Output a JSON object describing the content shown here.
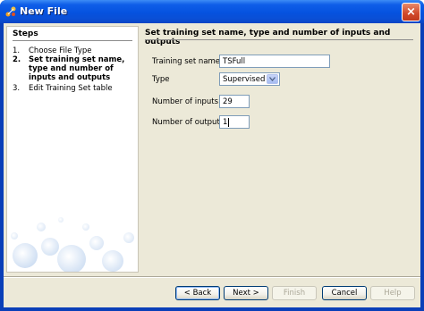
{
  "window": {
    "title": "New File",
    "app_icon": "app-icon",
    "close_icon": "close-icon",
    "close_glyph": "×"
  },
  "steps": {
    "title": "Steps",
    "items": [
      {
        "num": "1.",
        "label": "Choose File Type",
        "current": false
      },
      {
        "num": "2.",
        "label": "Set training set name, type and number of inputs and outputs",
        "current": true
      },
      {
        "num": "3.",
        "label": "Edit Training Set table",
        "current": false
      }
    ]
  },
  "form": {
    "title": "Set training set name, type and number of inputs and outputs",
    "name_label": "Training set name",
    "name_value": "TSFull",
    "type_label": "Type",
    "type_value": "Supervised",
    "inputs_label": "Number of inputs",
    "inputs_value": "29",
    "outputs_label": "Number of outputs",
    "outputs_value": "1"
  },
  "buttons": {
    "back": "< Back",
    "next": "Next >",
    "finish": "Finish",
    "cancel": "Cancel",
    "help": "Help"
  },
  "colors": {
    "titlebar": "#0552df",
    "dialog_bg": "#ece9d8",
    "field_border": "#7f9db9"
  }
}
